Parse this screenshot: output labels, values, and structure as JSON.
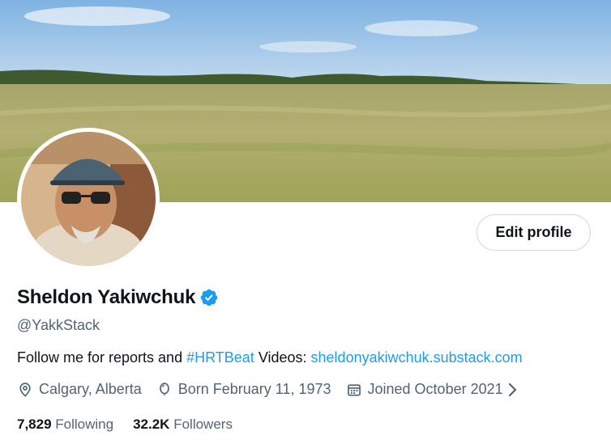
{
  "profile": {
    "name": "Sheldon Yakiwchuk",
    "handle": "@YakkStack",
    "bio_text": "Follow me for reports and ",
    "bio_hashtag": "#HRTBeat",
    "bio_videos_label": " Videos: ",
    "bio_link": "sheldonyakiwchuk.substack.com",
    "location": "Calgary, Alberta",
    "birthday": "Born February 11, 1973",
    "joined": "Joined October 2021",
    "following_count": "7,829",
    "following_label": "Following",
    "followers_count": "32.2K",
    "followers_label": "Followers"
  },
  "actions": {
    "edit_profile_label": "Edit profile"
  },
  "icons": {
    "verified": "verified-badge-icon",
    "location": "location-pin-icon",
    "birthday": "balloon-icon",
    "joined": "calendar-icon",
    "chevron": "chevron-right-icon"
  },
  "colors": {
    "accent": "#1d9bf0",
    "secondary_text": "#536471",
    "primary_text": "#0f1419",
    "border": "#cfd9de"
  }
}
